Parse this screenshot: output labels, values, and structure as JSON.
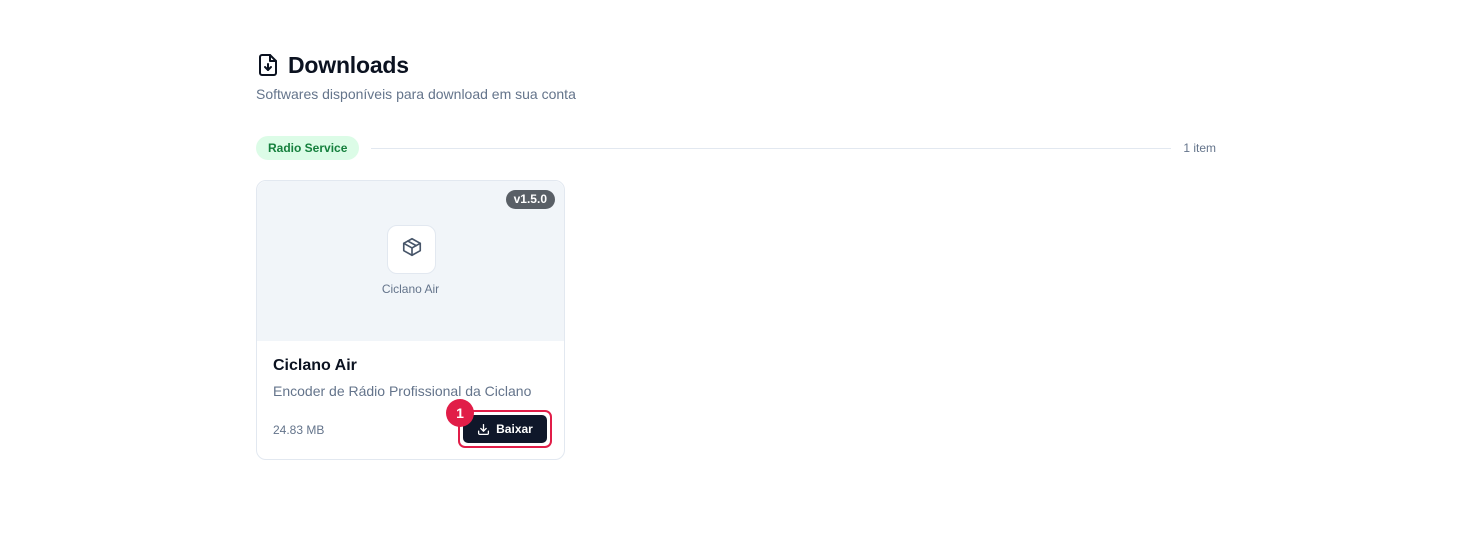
{
  "header": {
    "title": "Downloads",
    "subtitle": "Softwares disponíveis para download em sua conta",
    "icon": "file-download-icon"
  },
  "group": {
    "name": "Radio Service",
    "count": "1 item",
    "badge_color": "#dcfce7",
    "badge_text_color": "#15803d"
  },
  "items": [
    {
      "version": "v1.5.0",
      "media_label": "Ciclano Air",
      "icon": "package-icon",
      "title": "Ciclano Air",
      "description": "Encoder de Rádio Profissional da Ciclano",
      "size": "24.83 MB",
      "download_label": "Baixar",
      "download_icon": "download-icon"
    }
  ],
  "annotation": {
    "step": "1",
    "color": "#e11d48"
  },
  "colors": {
    "primary_button": "#0f172a",
    "media_background": "#f1f5f9",
    "muted_text": "#64748b"
  }
}
